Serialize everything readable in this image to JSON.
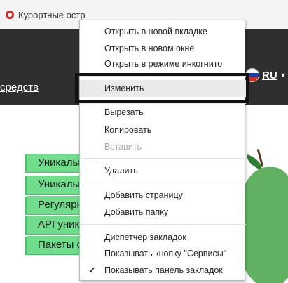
{
  "bookmarks_bar": {
    "items": [
      {
        "label": "Курортные остр",
        "icon": "resort-favicon"
      }
    ]
  },
  "site": {
    "nav_link": "средств",
    "language": {
      "code": "RU",
      "flag": "russian-flag-icon"
    }
  },
  "content": {
    "menu_items": [
      "Уникальн",
      "Уникальн",
      "Регулярн",
      "API уника",
      "Пакеты с"
    ]
  },
  "context_menu": {
    "items": [
      {
        "label": "Открыть в новой вкладке",
        "enabled": true
      },
      {
        "label": "Открыть в новом окне",
        "enabled": true
      },
      {
        "label": "Открыть в режиме инкогнито",
        "enabled": true
      },
      {
        "label": "Изменить",
        "enabled": true,
        "highlighted": true
      },
      {
        "label": "Вырезать",
        "enabled": true
      },
      {
        "label": "Копировать",
        "enabled": true
      },
      {
        "label": "Вставить",
        "enabled": false
      },
      {
        "label": "Удалить",
        "enabled": true
      },
      {
        "label": "Добавить страницу",
        "enabled": true
      },
      {
        "label": "Добавить папку",
        "enabled": true
      },
      {
        "label": "Диспетчер закладок",
        "enabled": true
      },
      {
        "label": "Показывать кнопку \"Сервисы\"",
        "enabled": true
      },
      {
        "label": "Показывать панель закладок",
        "enabled": true,
        "checked": true
      }
    ]
  },
  "colors": {
    "header_bg": "#2f2f2f",
    "menu_accent_green": "#6fdd8b",
    "pear_green": "#62b062",
    "favicon_red": "#d62a2a"
  }
}
